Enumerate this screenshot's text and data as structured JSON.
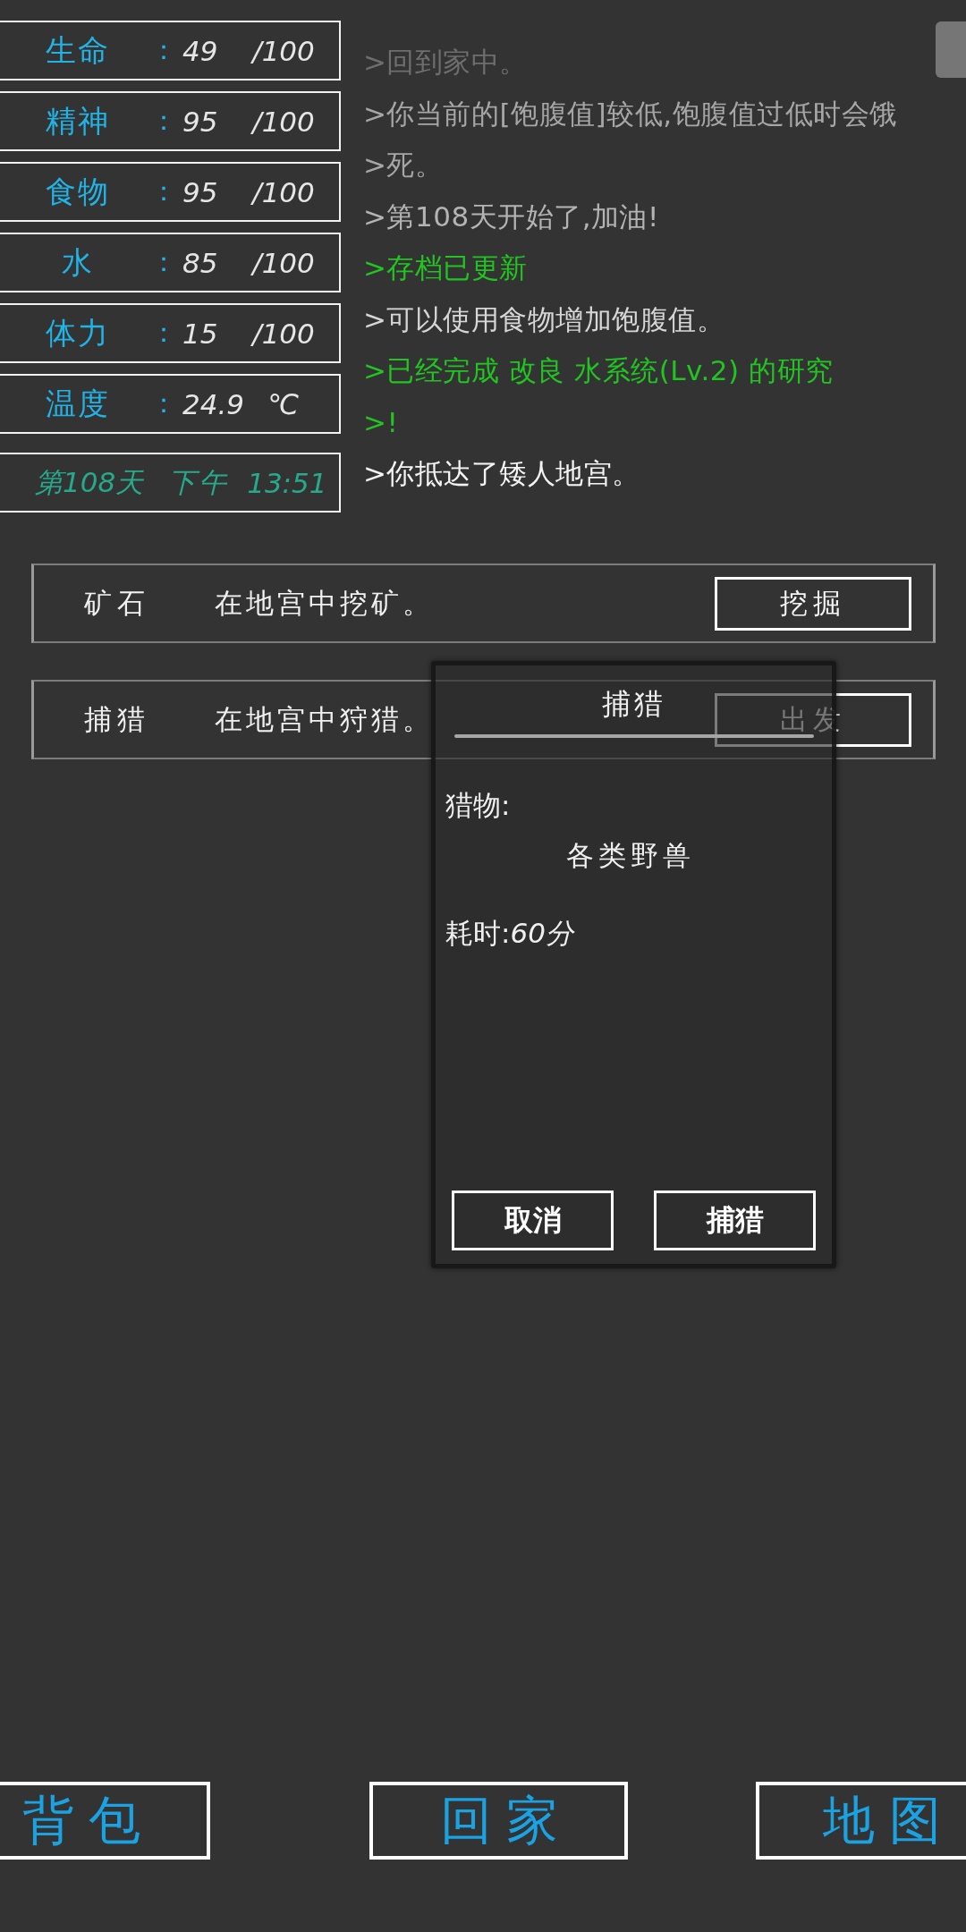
{
  "stats": [
    {
      "label": "生命",
      "separator": "：",
      "value": "49",
      "suffix": "/100"
    },
    {
      "label": "精神",
      "separator": "：",
      "value": "95",
      "suffix": "/100"
    },
    {
      "label": "食物",
      "separator": "：",
      "value": "95",
      "suffix": "/100"
    },
    {
      "label": "水",
      "separator": "：",
      "value": "85",
      "suffix": "/100"
    },
    {
      "label": "体力",
      "separator": "：",
      "value": "15",
      "suffix": "/100"
    },
    {
      "label": "温度",
      "separator": "：",
      "value": "24.9",
      "suffix": "℃"
    }
  ],
  "clock": {
    "day": "第108天",
    "period": "下午",
    "time": "13:51"
  },
  "log": [
    {
      "text": ">回到家中。",
      "color": "#6e6e6e"
    },
    {
      "text": ">你当前的[饱腹值]较低,饱腹值过低时会饿",
      "color": "#a6a6a6"
    },
    {
      "text": ">死。",
      "color": "#a6a6a6"
    },
    {
      "text": ">第108天开始了,加油!",
      "color": "#b4b4b4"
    },
    {
      "text": ">存档已更新",
      "color": "#22c422"
    },
    {
      "text": ">可以使用食物增加饱腹值。",
      "color": "#d6d6d6"
    },
    {
      "text": ">已经完成 改良 水系统(Lv.2) 的研究",
      "color": "#22c422"
    },
    {
      "text": ">!",
      "color": "#22c422"
    },
    {
      "text": ">你抵达了矮人地宫。",
      "color": "#f4f4f4"
    }
  ],
  "actions": [
    {
      "name": "矿石",
      "description": "在地宫中挖矿。",
      "button": "挖掘"
    },
    {
      "name": "捕猎",
      "description": "在地宫中狩猎。",
      "button": "出发"
    }
  ],
  "dialog": {
    "title": "捕猎",
    "fields": [
      {
        "kind": "stacked",
        "label": "猎物:",
        "value": "各类野兽"
      },
      {
        "kind": "inline",
        "label": "耗时:",
        "value": "60分"
      }
    ],
    "buttons": [
      "取消",
      "捕猎"
    ]
  },
  "nav": [
    "背包",
    "回家",
    "地图"
  ]
}
